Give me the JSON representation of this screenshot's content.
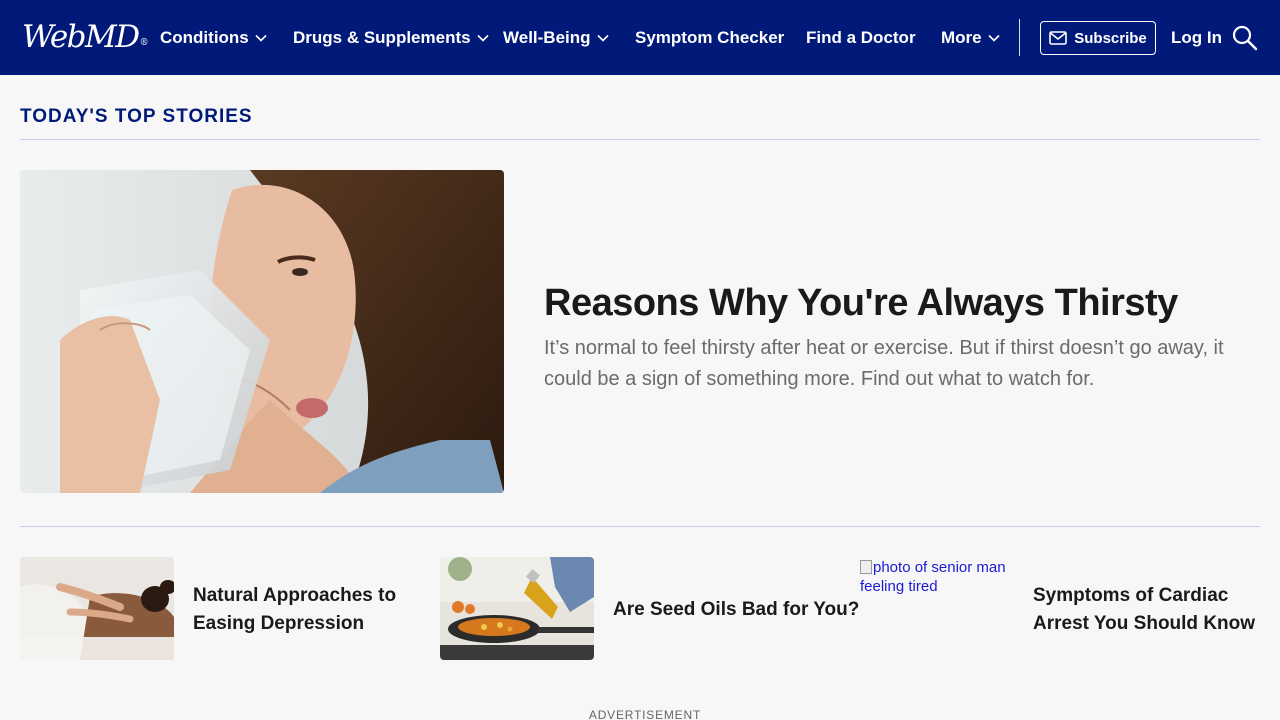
{
  "header": {
    "logo": "WebMD",
    "nav": [
      {
        "label": "Conditions",
        "dropdown": true
      },
      {
        "label": "Drugs & Supplements",
        "dropdown": true
      },
      {
        "label": "Well-Being",
        "dropdown": true
      },
      {
        "label": "Symptom Checker",
        "dropdown": false
      },
      {
        "label": "Find a Doctor",
        "dropdown": false
      },
      {
        "label": "More",
        "dropdown": true
      }
    ],
    "subscribe_label": "Subscribe",
    "login_label": "Log In",
    "search_icon": "search-icon",
    "background_color": "#011a7a"
  },
  "section": {
    "title": "TODAY'S TOP STORIES"
  },
  "hero": {
    "title": "Reasons Why You're Always Thirsty",
    "description": "It’s normal to feel thirsty after heat or exercise. But if thirst doesn’t go away, it could be a sign of something more. Find out what to watch for."
  },
  "cards": [
    {
      "title_line1": "Natural Approaches to",
      "title_line2": "Easing Depression"
    },
    {
      "title_line1": "Are Seed Oils Bad for You?",
      "title_line2": ""
    },
    {
      "title_line1": "Symptoms of Cardiac",
      "title_line2": "Arrest You Should Know",
      "image_alt": "photo of senior man feeling tired"
    }
  ],
  "advertisement_label": "ADVERTISEMENT",
  "colors": {
    "brand_navy": "#011a7a",
    "link_blue": "#1a1ad6",
    "muted_text": "#6b6b6b"
  }
}
